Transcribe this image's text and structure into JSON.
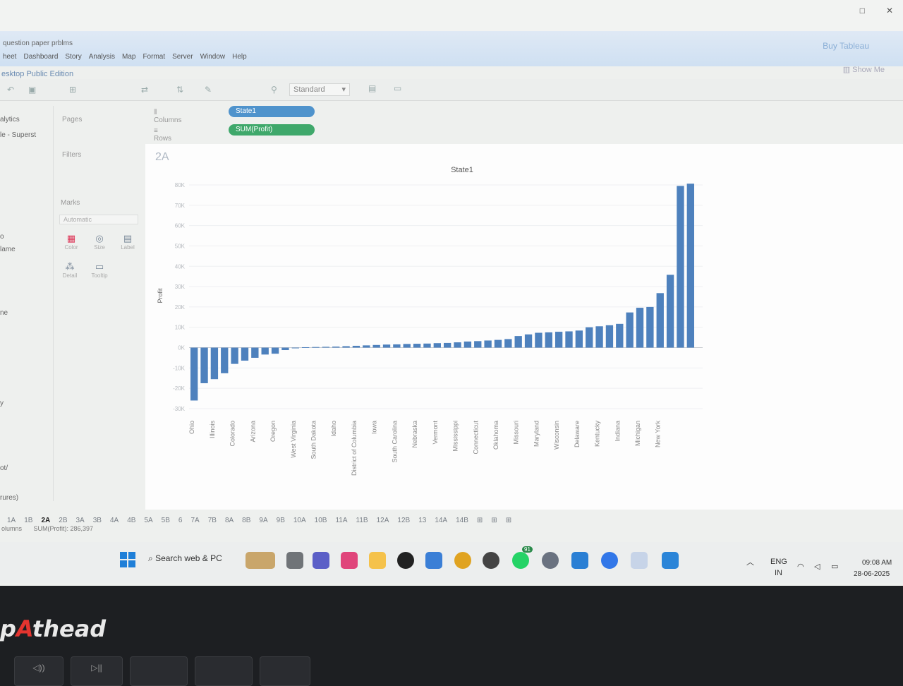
{
  "window": {
    "title": "question paper prblms",
    "edition": "esktop Public Edition",
    "buy_label": "Buy Tableau",
    "controls": [
      "□",
      "✕"
    ]
  },
  "menu": [
    "heet",
    "Dashboard",
    "Story",
    "Analysis",
    "Map",
    "Format",
    "Server",
    "Window",
    "Help"
  ],
  "toolbar": {
    "fit_mode": "Standard",
    "show_me": "Show Me"
  },
  "left_panel": {
    "tab": "alytics",
    "datasource": "le - Superst",
    "items": [
      "o",
      "lame",
      "ne",
      "y",
      "ot/",
      "rures)"
    ]
  },
  "cards": {
    "pages": "Pages",
    "filters": "Filters",
    "marks": "Marks",
    "marks_type": "Automatic",
    "mark_buttons": [
      "Color",
      "Size",
      "Label",
      "Detail",
      "Tooltip"
    ]
  },
  "shelves": {
    "columns_label": "Columns",
    "rows_label": "Rows",
    "columns_pill": "State1",
    "rows_pill": "SUM(Profit)"
  },
  "sheet": {
    "name": "2A"
  },
  "chart_data": {
    "type": "bar",
    "title": "State1",
    "ylabel": "Profit",
    "ylim": [
      -30000,
      80000
    ],
    "yticks": [
      "80K",
      "70K",
      "60K",
      "50K",
      "40K",
      "30K",
      "20K",
      "10K",
      "0K",
      "-10K",
      "-20K",
      "-30K"
    ],
    "color": "#4e81bd",
    "labeled_categories": [
      "Ohio",
      "Illinois",
      "Colorado",
      "Arizona",
      "Oregon",
      "West Virginia",
      "South Dakota",
      "Idaho",
      "District of Columbia",
      "Iowa",
      "South Carolina",
      "Nebraska",
      "Vermont",
      "Mississippi",
      "Connecticut",
      "Oklahoma",
      "Missouri",
      "Maryland",
      "Wisconsin",
      "Delaware",
      "Kentucky",
      "Indiana",
      "Michigan",
      "New York"
    ],
    "values": [
      -26000,
      -17500,
      -15500,
      -12600,
      -8000,
      -6400,
      -5000,
      -3400,
      -3000,
      -1200,
      -100,
      200,
      300,
      400,
      500,
      700,
      900,
      1100,
      1300,
      1500,
      1600,
      1800,
      1900,
      2000,
      2200,
      2300,
      2600,
      3000,
      3200,
      3500,
      3800,
      4200,
      5700,
      6500,
      7300,
      7500,
      7800,
      8000,
      8400,
      10000,
      10500,
      11000,
      11700,
      17300,
      19600,
      20000,
      26800,
      35800,
      79500,
      80600
    ]
  },
  "sheet_tabs": [
    "1A",
    "1B",
    "2A",
    "2B",
    "3A",
    "3B",
    "4A",
    "4B",
    "5A",
    "5B",
    "6",
    "7A",
    "7B",
    "8A",
    "8B",
    "9A",
    "9B",
    "10A",
    "10B",
    "11A",
    "11B",
    "12A",
    "12B",
    "13",
    "14A",
    "14B"
  ],
  "active_tab": "2A",
  "status": {
    "left": "olumns",
    "sum": "SUM(Profit): 286,397"
  },
  "taskbar": {
    "search": "Search web & PC",
    "badge": "91",
    "lang": "ENG",
    "region": "IN",
    "time": "09:08 AM",
    "date": "28-06-2025"
  },
  "laptop": {
    "brand_a": "A",
    "brand_rest": "thead",
    "brand_prefix": "p"
  }
}
